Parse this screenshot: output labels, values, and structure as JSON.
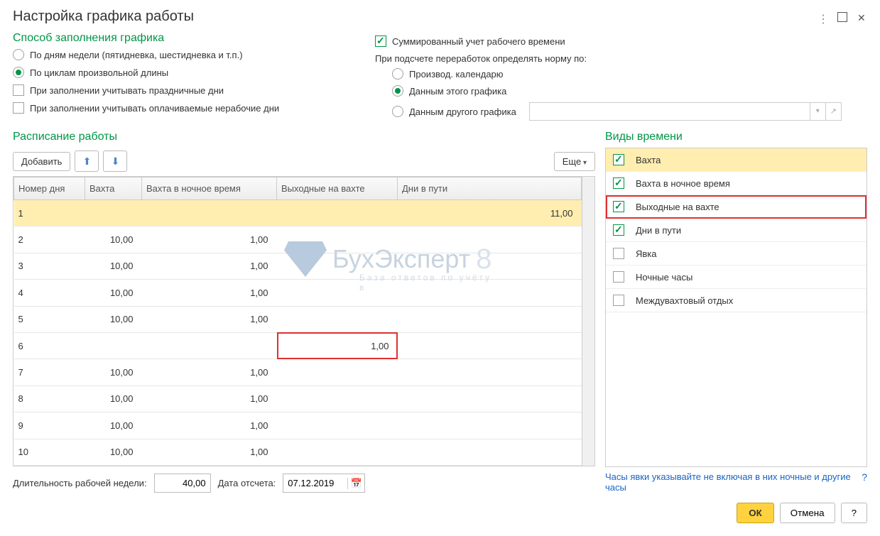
{
  "title": "Настройка графика работы",
  "method": {
    "heading": "Способ заполнения графика",
    "opt_by_weekdays": "По дням недели (пятидневка, шестидневка и т.п.)",
    "opt_by_cycles": "По циклам произвольной длины",
    "chk_holidays": "При заполнении учитывать праздничные дни",
    "chk_paid_nonwork": "При заполнении учитывать оплачиваемые нерабочие дни"
  },
  "sumtime": {
    "chk_sum": "Суммированный учет рабочего времени",
    "norm_label": "При подсчете переработок определять норму по:",
    "opt_prod_cal": "Производ. календарю",
    "opt_this_sched": "Данным этого графика",
    "opt_other_sched": "Данным другого графика"
  },
  "schedule": {
    "heading": "Расписание работы",
    "btn_add": "Добавить",
    "btn_more": "Еще",
    "col_num": "Номер дня",
    "col_shift": "Вахта",
    "col_night": "Вахта в ночное время",
    "col_dayoff": "Выходные на вахте",
    "col_travel": "Дни в пути",
    "rows": [
      {
        "n": "1",
        "shift": "",
        "night": "",
        "dayoff": "",
        "travel": "11,00"
      },
      {
        "n": "2",
        "shift": "10,00",
        "night": "1,00",
        "dayoff": "",
        "travel": ""
      },
      {
        "n": "3",
        "shift": "10,00",
        "night": "1,00",
        "dayoff": "",
        "travel": ""
      },
      {
        "n": "4",
        "shift": "10,00",
        "night": "1,00",
        "dayoff": "",
        "travel": ""
      },
      {
        "n": "5",
        "shift": "10,00",
        "night": "1,00",
        "dayoff": "",
        "travel": ""
      },
      {
        "n": "6",
        "shift": "",
        "night": "",
        "dayoff": "1,00",
        "travel": ""
      },
      {
        "n": "7",
        "shift": "10,00",
        "night": "1,00",
        "dayoff": "",
        "travel": ""
      },
      {
        "n": "8",
        "shift": "10,00",
        "night": "1,00",
        "dayoff": "",
        "travel": ""
      },
      {
        "n": "9",
        "shift": "10,00",
        "night": "1,00",
        "dayoff": "",
        "travel": ""
      },
      {
        "n": "10",
        "shift": "10,00",
        "night": "1,00",
        "dayoff": "",
        "travel": ""
      }
    ]
  },
  "types": {
    "heading": "Виды времени",
    "items": [
      {
        "label": "Вахта",
        "checked": true,
        "sel": true
      },
      {
        "label": "Вахта в ночное время",
        "checked": true
      },
      {
        "label": "Выходные на вахте",
        "checked": true,
        "highlight": true
      },
      {
        "label": "Дни в пути",
        "checked": true
      },
      {
        "label": "Явка",
        "checked": false
      },
      {
        "label": "Ночные часы",
        "checked": false
      },
      {
        "label": "Междувахтовый отдых",
        "checked": false
      }
    ],
    "hint": "Часы явки указывайте не включая в них ночные и другие часы"
  },
  "bottom": {
    "week_len_label": "Длительность рабочей недели:",
    "week_len_value": "40,00",
    "date_from_label": "Дата отсчета:",
    "date_from_value": "07.12.2019"
  },
  "footer": {
    "ok": "ОК",
    "cancel": "Отмена",
    "help": "?"
  },
  "watermark": {
    "main": "БухЭксперт",
    "sub": "База ответов по учёту в",
    "eight": "8"
  }
}
